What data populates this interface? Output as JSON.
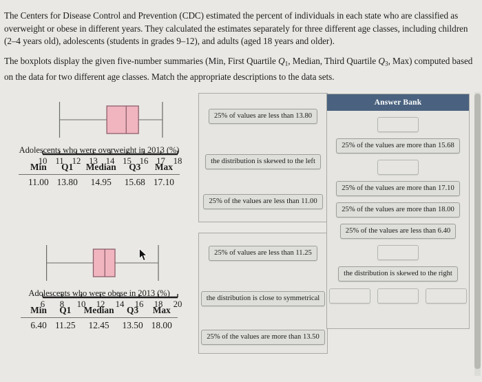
{
  "intro": {
    "paragraph1_a": "The Centers for Disease Control and Prevention (CDC) estimated the percent of individuals in each state who are classified as overweight or obese in different years. They calculated the estimates separately for three different age classes, including children (2–4 years old), adolescents (students in grades 9–12), and adults (aged 18 years and older).",
    "paragraph2_pre": "The boxplots display the given five-number summaries (Min, First Quartile ",
    "paragraph2_q1": "Q",
    "paragraph2_q1_sub": "1",
    "paragraph2_mid": ", Median, Third Quartile ",
    "paragraph2_q3": "Q",
    "paragraph2_q3_sub": "3",
    "paragraph2_post": ", Max) computed based on the data for two different age classes. Match the appropriate descriptions to the data sets."
  },
  "colors": {
    "page_background": "#e9e8e4",
    "box_fill": "#f0b5bf",
    "box_stroke": "#8d5f6b",
    "whisker_stroke": "#6a6a68",
    "answer_bank_header": "#4a627f",
    "chip_fill": "#dededa",
    "chip_border": "#9d9d9a",
    "panel_border": "#a9a9a6"
  },
  "chart_data": [
    {
      "type": "boxplot",
      "id": "adolescents-overweight-2013",
      "title": "Adolescents who were overweight in 2013 (%)",
      "xlabel": "Adolescents who were overweight in 2013 (%)",
      "ylabel": "",
      "xlim": [
        10,
        18
      ],
      "ticks": [
        10,
        11,
        12,
        13,
        14,
        15,
        16,
        17,
        18
      ],
      "tick_labels": [
        "10",
        "11",
        "12",
        "13",
        "14",
        "15",
        "16",
        "17",
        "18"
      ],
      "grid": false,
      "five_number_summary": {
        "min": 11.0,
        "q1": 13.8,
        "median": 14.95,
        "q3": 15.68,
        "max": 17.1
      },
      "table": {
        "headers": [
          "Min",
          "Q1",
          "Median",
          "Q3",
          "Max"
        ],
        "values": [
          "11.00",
          "13.80",
          "14.95",
          "15.68",
          "17.10"
        ]
      }
    },
    {
      "type": "boxplot",
      "id": "adolescents-obese-2013",
      "title": "Adolescents who were obese in 2013 (%)",
      "xlabel": "Adolescents who were obese in 2013 (%)",
      "ylabel": "",
      "xlim": [
        6,
        20
      ],
      "ticks": [
        6,
        8,
        10,
        12,
        14,
        16,
        18,
        20
      ],
      "tick_labels": [
        "6",
        "8",
        "10",
        "12",
        "14",
        "16",
        "18",
        "20"
      ],
      "grid": false,
      "five_number_summary": {
        "min": 6.4,
        "q1": 11.25,
        "median": 12.45,
        "q3": 13.5,
        "max": 18.0
      },
      "table": {
        "headers": [
          "Min",
          "Q1",
          "Median",
          "Q3",
          "Max"
        ],
        "values": [
          "6.40",
          "11.25",
          "12.45",
          "13.50",
          "18.00"
        ]
      }
    }
  ],
  "dropzones": [
    {
      "id": "dropzone-overweight",
      "chips": [
        {
          "label": "25% of values are less than 13.80",
          "empty": false
        },
        {
          "label": "the distribution is skewed to the left",
          "empty": false
        },
        {
          "label": "25% of the values are less than 11.00",
          "empty": false
        }
      ]
    },
    {
      "id": "dropzone-obese",
      "chips": [
        {
          "label": "25% of values are less than 11.25",
          "empty": false
        },
        {
          "label": "the distribution is close to symmetrical",
          "empty": false
        },
        {
          "label": "25% of the values are more than 13.50",
          "empty": false
        }
      ]
    }
  ],
  "answer_bank": {
    "title": "Answer Bank",
    "rows": [
      {
        "items": [
          {
            "label": "",
            "empty": true
          }
        ]
      },
      {
        "items": [
          {
            "label": "25% of the values are more than 15.68",
            "empty": false
          }
        ]
      },
      {
        "items": [
          {
            "label": "",
            "empty": true
          }
        ]
      },
      {
        "items": [
          {
            "label": "25% of the values are more than 17.10",
            "empty": false
          }
        ]
      },
      {
        "items": [
          {
            "label": "25% of the values are more than 18.00",
            "empty": false
          }
        ]
      },
      {
        "items": [
          {
            "label": "25% of the values are less than 6.40",
            "empty": false
          }
        ]
      },
      {
        "items": [
          {
            "label": "",
            "empty": true
          }
        ]
      },
      {
        "items": [
          {
            "label": "the distribution is skewed to the right",
            "empty": false
          }
        ]
      },
      {
        "items": [
          {
            "label": "",
            "empty": true
          },
          {
            "label": "",
            "empty": true
          },
          {
            "label": "",
            "empty": true
          }
        ]
      }
    ]
  }
}
